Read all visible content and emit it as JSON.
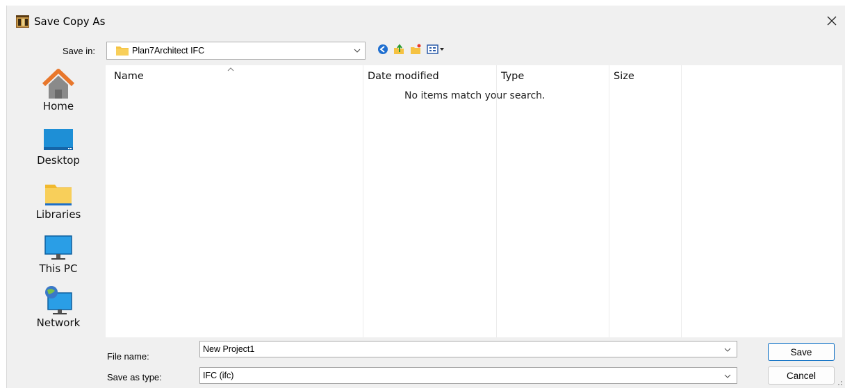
{
  "window": {
    "title": "Save Copy As"
  },
  "save_in": {
    "label": "Save in:",
    "value": "Plan7Architect IFC"
  },
  "toolbar": {
    "icons": [
      "back-icon",
      "up-folder-icon",
      "new-folder-icon",
      "view-menu-icon"
    ]
  },
  "places": [
    {
      "id": "home",
      "label": "Home",
      "icon": "home-icon"
    },
    {
      "id": "desktop",
      "label": "Desktop",
      "icon": "desktop-icon"
    },
    {
      "id": "libraries",
      "label": "Libraries",
      "icon": "libraries-icon"
    },
    {
      "id": "this-pc",
      "label": "This PC",
      "icon": "this-pc-icon"
    },
    {
      "id": "network",
      "label": "Network",
      "icon": "network-icon"
    }
  ],
  "file_list": {
    "columns": [
      "Name",
      "Date modified",
      "Type",
      "Size"
    ],
    "empty_message": "No items match your search."
  },
  "file_name": {
    "label": "File name:",
    "value": "New Project1"
  },
  "save_as_type": {
    "label": "Save as type:",
    "value": "IFC (ifc)"
  },
  "buttons": {
    "save": "Save",
    "cancel": "Cancel"
  },
  "colors": {
    "accent": "#0067c0",
    "folder": "#f5c242",
    "desktop_blue": "#1e8fd6"
  }
}
